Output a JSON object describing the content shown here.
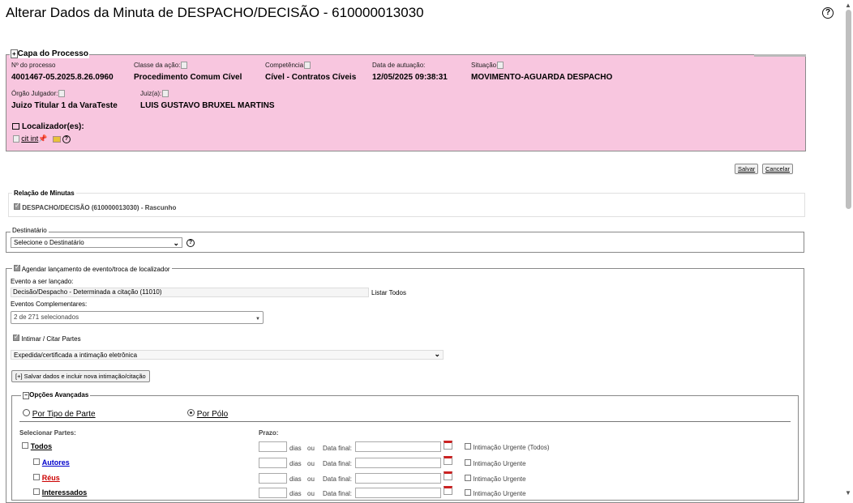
{
  "page": {
    "title": "Alterar Dados da Minuta de DESPACHO/DECISÃO - 610000013030",
    "help": "?"
  },
  "capa": {
    "legend": "Capa do Processo",
    "toggle": "+",
    "fields": {
      "numero_label": "Nº do processo",
      "numero": "4001467-05.2025.8.26.0960",
      "classe_label": "Classe da ação:",
      "classe": "Procedimento Comum Cível",
      "competencia_label": "Competência",
      "competencia": "Cível - Contratos Cíveis",
      "data_label": "Data de autuação:",
      "data": "12/05/2025 09:38:31",
      "situacao_label": "Situação",
      "situacao": "MOVIMENTO-AGUARDA DESPACHO",
      "orgao_label": "Órgão Julgador:",
      "orgao": "Juizo Titular 1 da VaraTeste",
      "juiz_label": "Juiz(a):",
      "juiz": "LUIS GUSTAVO BRUXEL MARTINS"
    },
    "localizador_label": "Localizador(es):",
    "localizador_link": "cit int",
    "help": "?"
  },
  "actions": {
    "salvar": "Salvar",
    "cancelar": "Cancelar"
  },
  "relacao": {
    "legend": "Relação de Minutas",
    "item": "DESPACHO/DECISÃO (610000013030) - Rascunho"
  },
  "destinatario": {
    "legend": "Destinatário",
    "selected": "Selecione o Destinatário",
    "help": "?"
  },
  "agendar": {
    "legend": "Agendar lançamento de evento/troca de localizador",
    "evento_label": "Evento a ser lançado:",
    "evento_value": "Decisão/Despacho - Determinada a citação (11010)",
    "listar_todos": "Listar Todos",
    "complementares_label": "Eventos Complementares:",
    "complementares_value": "2 de 271 selecionados",
    "intimar_label": "Intimar / Citar Partes",
    "intimacao_select": "Expedida/certificada a intimação eletrônica",
    "salvar_incluir": "[+] Salvar dados e incluir nova intimação/citação"
  },
  "opcoes": {
    "legend": "Opções Avançadas",
    "toggle": "−",
    "por_tipo": "Por Tipo de Parte",
    "por_polo": "Por Pólo",
    "selecionar_partes": "Selecionar Partes:",
    "prazo": "Prazo:",
    "dias": "dias",
    "ou": "ou",
    "data_final": "Data final:",
    "rows": [
      {
        "label": "Todos",
        "style": "todos",
        "urgente": "Intimação Urgente (Todos)"
      },
      {
        "label": "Autores",
        "style": "blue",
        "urgente": "Intimação Urgente"
      },
      {
        "label": "Réus",
        "style": "red",
        "urgente": "Intimação Urgente"
      },
      {
        "label": "Interessados",
        "style": "plain",
        "urgente": "Intimação Urgente"
      }
    ]
  }
}
